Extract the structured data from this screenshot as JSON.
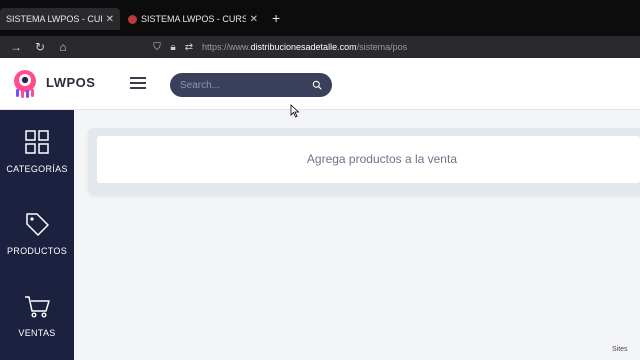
{
  "browser": {
    "tabs": [
      {
        "title": "SISTEMA LWPOS - CURSO",
        "active": true
      },
      {
        "title": "SISTEMA LWPOS - CURSO",
        "active": false
      }
    ],
    "new_tab_label": "+",
    "url_prefix": "https://www.",
    "url_domain": "distribucionesadetalle.com",
    "url_path": "/sistema/pos"
  },
  "app": {
    "brand": "LWPOS",
    "search": {
      "placeholder": "Search..."
    },
    "sidebar": {
      "items": [
        {
          "label": "CATEGORÍAS",
          "icon": "grid-icon"
        },
        {
          "label": "PRODUCTOS",
          "icon": "tag-icon"
        },
        {
          "label": "VENTAS",
          "icon": "cart-icon"
        }
      ]
    },
    "main": {
      "empty_message": "Agrega productos a la venta"
    }
  },
  "watermark": "Sites",
  "colors": {
    "sidebar": "#1d2140",
    "search_bg": "#3a3f5c",
    "logo_pink": "#ff4d8d"
  }
}
